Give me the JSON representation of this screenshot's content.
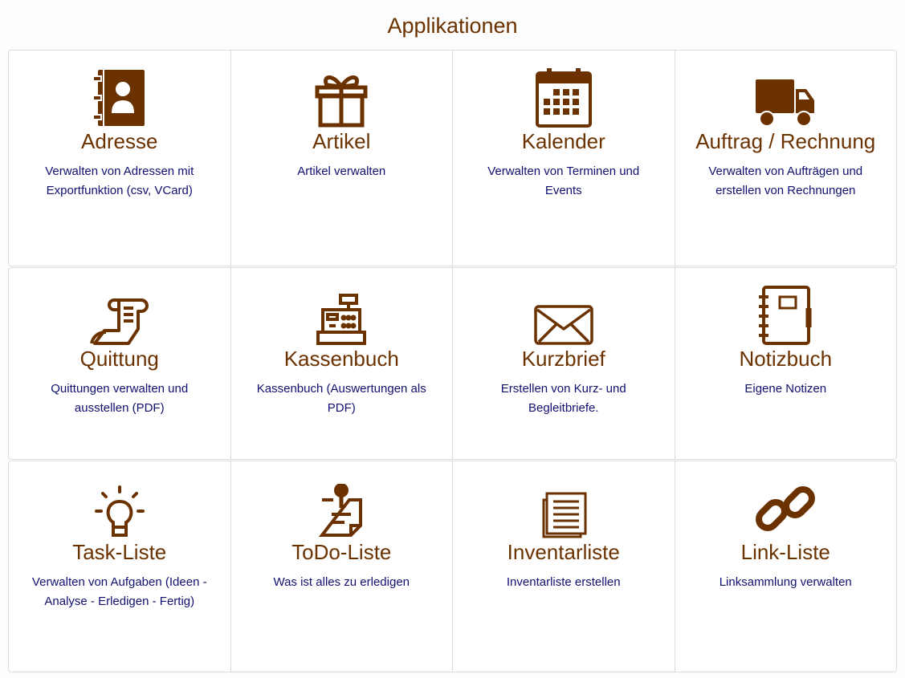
{
  "page": {
    "title": "Applikationen"
  },
  "colors": {
    "accent": "#6b3200",
    "description": "#101070",
    "border": "#dcdcdc"
  },
  "tiles": [
    {
      "icon": "address-book-icon",
      "title": "Adresse",
      "description": "Verwalten von Adressen mit Exportfunktion (csv, VCard)"
    },
    {
      "icon": "gift-icon",
      "title": "Artikel",
      "description": "Artikel verwalten"
    },
    {
      "icon": "calendar-icon",
      "title": "Kalender",
      "description": "Verwalten von Terminen und Events"
    },
    {
      "icon": "truck-icon",
      "title": "Auftrag / Rechnung",
      "description": "Verwalten von Aufträgen und erstellen von Rechnungen"
    },
    {
      "icon": "receipt-icon",
      "title": "Quittung",
      "description": "Quittungen verwalten und ausstellen (PDF)"
    },
    {
      "icon": "cash-register-icon",
      "title": "Kassenbuch",
      "description": "Kassenbuch (Auswertungen als PDF)"
    },
    {
      "icon": "envelope-icon",
      "title": "Kurzbrief",
      "description": "Erstellen von Kurz- und Begleitbriefe."
    },
    {
      "icon": "notebook-icon",
      "title": "Notizbuch",
      "description": "Eigene Notizen"
    },
    {
      "icon": "lightbulb-icon",
      "title": "Task-Liste",
      "description": "Verwalten von Aufgaben (Ideen - Analyse - Erledigen - Fertig)"
    },
    {
      "icon": "clipboard-pin-icon",
      "title": "ToDo-Liste",
      "description": "Was ist alles zu erledigen"
    },
    {
      "icon": "list-document-icon",
      "title": "Inventarliste",
      "description": "Inventarliste erstellen"
    },
    {
      "icon": "link-icon",
      "title": "Link-Liste",
      "description": "Linksammlung verwalten"
    }
  ]
}
